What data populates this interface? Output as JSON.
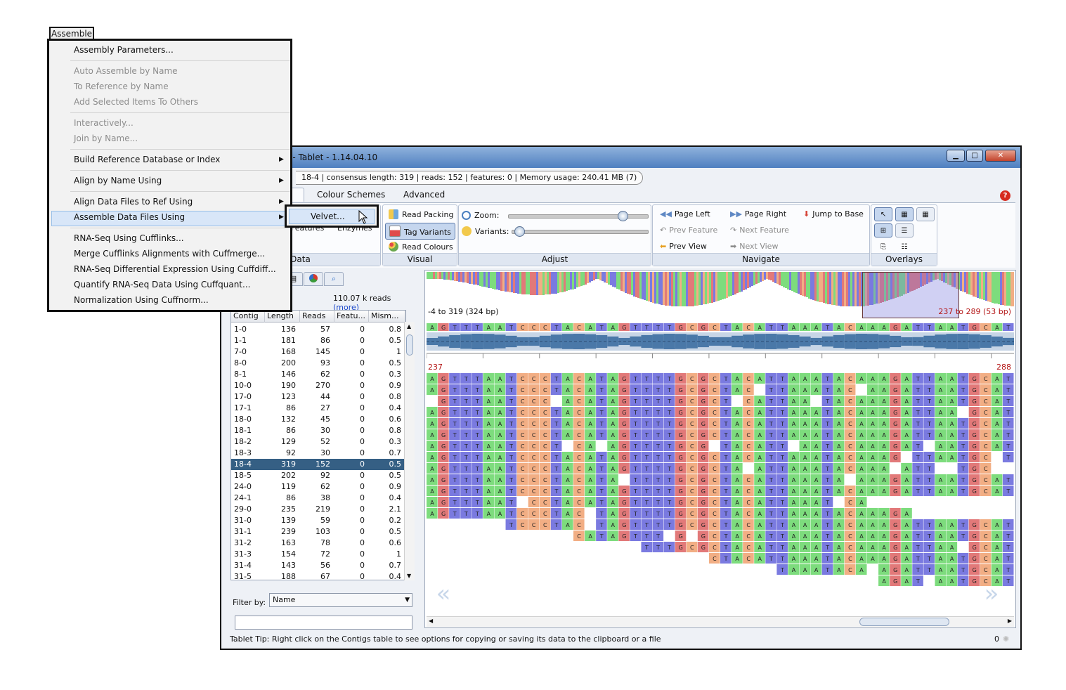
{
  "window": {
    "title": "g - Tablet - 1.14.04.10",
    "controls": [
      "minimize-icon",
      "maximize-icon",
      "close-icon"
    ]
  },
  "status": {
    "contig": "18-4",
    "consensus": "consensus length: 319",
    "reads": "reads: 152",
    "features": "features: 0",
    "memory": "Memory usage: 240.41 MB (7)"
  },
  "ribbon_tabs": [
    "e",
    "Colour Schemes",
    "Advanced"
  ],
  "ribbon": {
    "data_group": {
      "label": "Data",
      "import_features": "Import\nFeatures",
      "import_enzymes": "Import\nEnzymes"
    },
    "visual_group": {
      "label": "Visual",
      "read_packing": "Read Packing",
      "tag_variants": "Tag Variants",
      "read_colours": "Read Colours"
    },
    "adjust_group": {
      "label": "Adjust",
      "zoom": "Zoom:",
      "variants": "Variants:",
      "zoom_level": 0.82,
      "variants_level": 0.02
    },
    "navigate_group": {
      "label": "Navigate",
      "page_left": "Page Left",
      "page_right": "Page Right",
      "jump_to_base": "Jump to Base",
      "prev_feature": "Prev Feature",
      "next_feature": "Next Feature",
      "prev_view": "Prev View",
      "next_view": "Next View"
    },
    "overlays_group": {
      "label": "Overlays"
    }
  },
  "left_panel": {
    "reads_count": "110.07 k reads",
    "more_link": "(more)",
    "columns": [
      "Contig",
      "Length",
      "Reads",
      "Featu...",
      "Mism..."
    ],
    "rows": [
      [
        "1-0",
        "136",
        "57",
        "0",
        "0.8"
      ],
      [
        "1-1",
        "181",
        "86",
        "0",
        "0.5"
      ],
      [
        "7-0",
        "168",
        "145",
        "0",
        "1"
      ],
      [
        "8-0",
        "200",
        "93",
        "0",
        "0.5"
      ],
      [
        "8-1",
        "146",
        "62",
        "0",
        "0.3"
      ],
      [
        "10-0",
        "190",
        "270",
        "0",
        "0.9"
      ],
      [
        "17-0",
        "123",
        "44",
        "0",
        "0.8"
      ],
      [
        "17-1",
        "86",
        "27",
        "0",
        "0.4"
      ],
      [
        "18-0",
        "132",
        "45",
        "0",
        "0.6"
      ],
      [
        "18-1",
        "86",
        "30",
        "0",
        "0.8"
      ],
      [
        "18-2",
        "129",
        "52",
        "0",
        "0.3"
      ],
      [
        "18-3",
        "92",
        "30",
        "0",
        "0.7"
      ],
      [
        "18-4",
        "319",
        "152",
        "0",
        "0.5"
      ],
      [
        "18-5",
        "202",
        "92",
        "0",
        "0.5"
      ],
      [
        "24-0",
        "119",
        "62",
        "0",
        "0.9"
      ],
      [
        "24-1",
        "86",
        "38",
        "0",
        "0.4"
      ],
      [
        "29-0",
        "235",
        "219",
        "0",
        "2.1"
      ],
      [
        "31-0",
        "139",
        "59",
        "0",
        "0.2"
      ],
      [
        "31-1",
        "239",
        "103",
        "0",
        "0.5"
      ],
      [
        "31-2",
        "163",
        "78",
        "0",
        "0.6"
      ],
      [
        "31-3",
        "154",
        "72",
        "0",
        "1"
      ],
      [
        "31-4",
        "143",
        "56",
        "0",
        "0.7"
      ],
      [
        "31-5",
        "188",
        "67",
        "0",
        "0.4"
      ]
    ],
    "selected_row": 12,
    "filter_label": "Filter by:",
    "filter_value": "Name",
    "filter_text": ""
  },
  "viewer": {
    "overview_left": "-4 to 319 (324 bp)",
    "overview_right": "237 to 289 (53 bp)",
    "start_pos": "237",
    "end_pos": "288",
    "consensus": "AGTTTAATCCCTACATAGTTTTGCGCTACATTAAATACAAAGATTAATGCAT",
    "base_colors": {
      "A": "#7ddc7d",
      "C": "#f2ae84",
      "G": "#e27979",
      "T": "#7a7ae0"
    }
  },
  "tip": {
    "text": "Tablet Tip:  Right click on the Contigs table to see options for copying or saving its data to the clipboard or a file",
    "count": "0"
  },
  "menu": {
    "tab": "Assemble",
    "items": [
      "Assembly Parameters...",
      "Auto Assemble by Name",
      "To Reference by Name",
      "Add Selected Items To Others",
      "Interactively...",
      "Join by Name...",
      "Build Reference Database or Index",
      "Align by Name Using",
      "Align Data Files to Ref Using",
      "Assemble Data Files Using",
      "RNA-Seq Using Cufflinks...",
      "Merge Cufflinks Alignments with Cuffmerge...",
      "RNA-Seq Differential Expression Using Cuffdiff...",
      "Quantify RNA-Seq Data Using Cuffquant...",
      "Normalization Using Cuffnorm..."
    ],
    "submenu_item": "Velvet..."
  }
}
